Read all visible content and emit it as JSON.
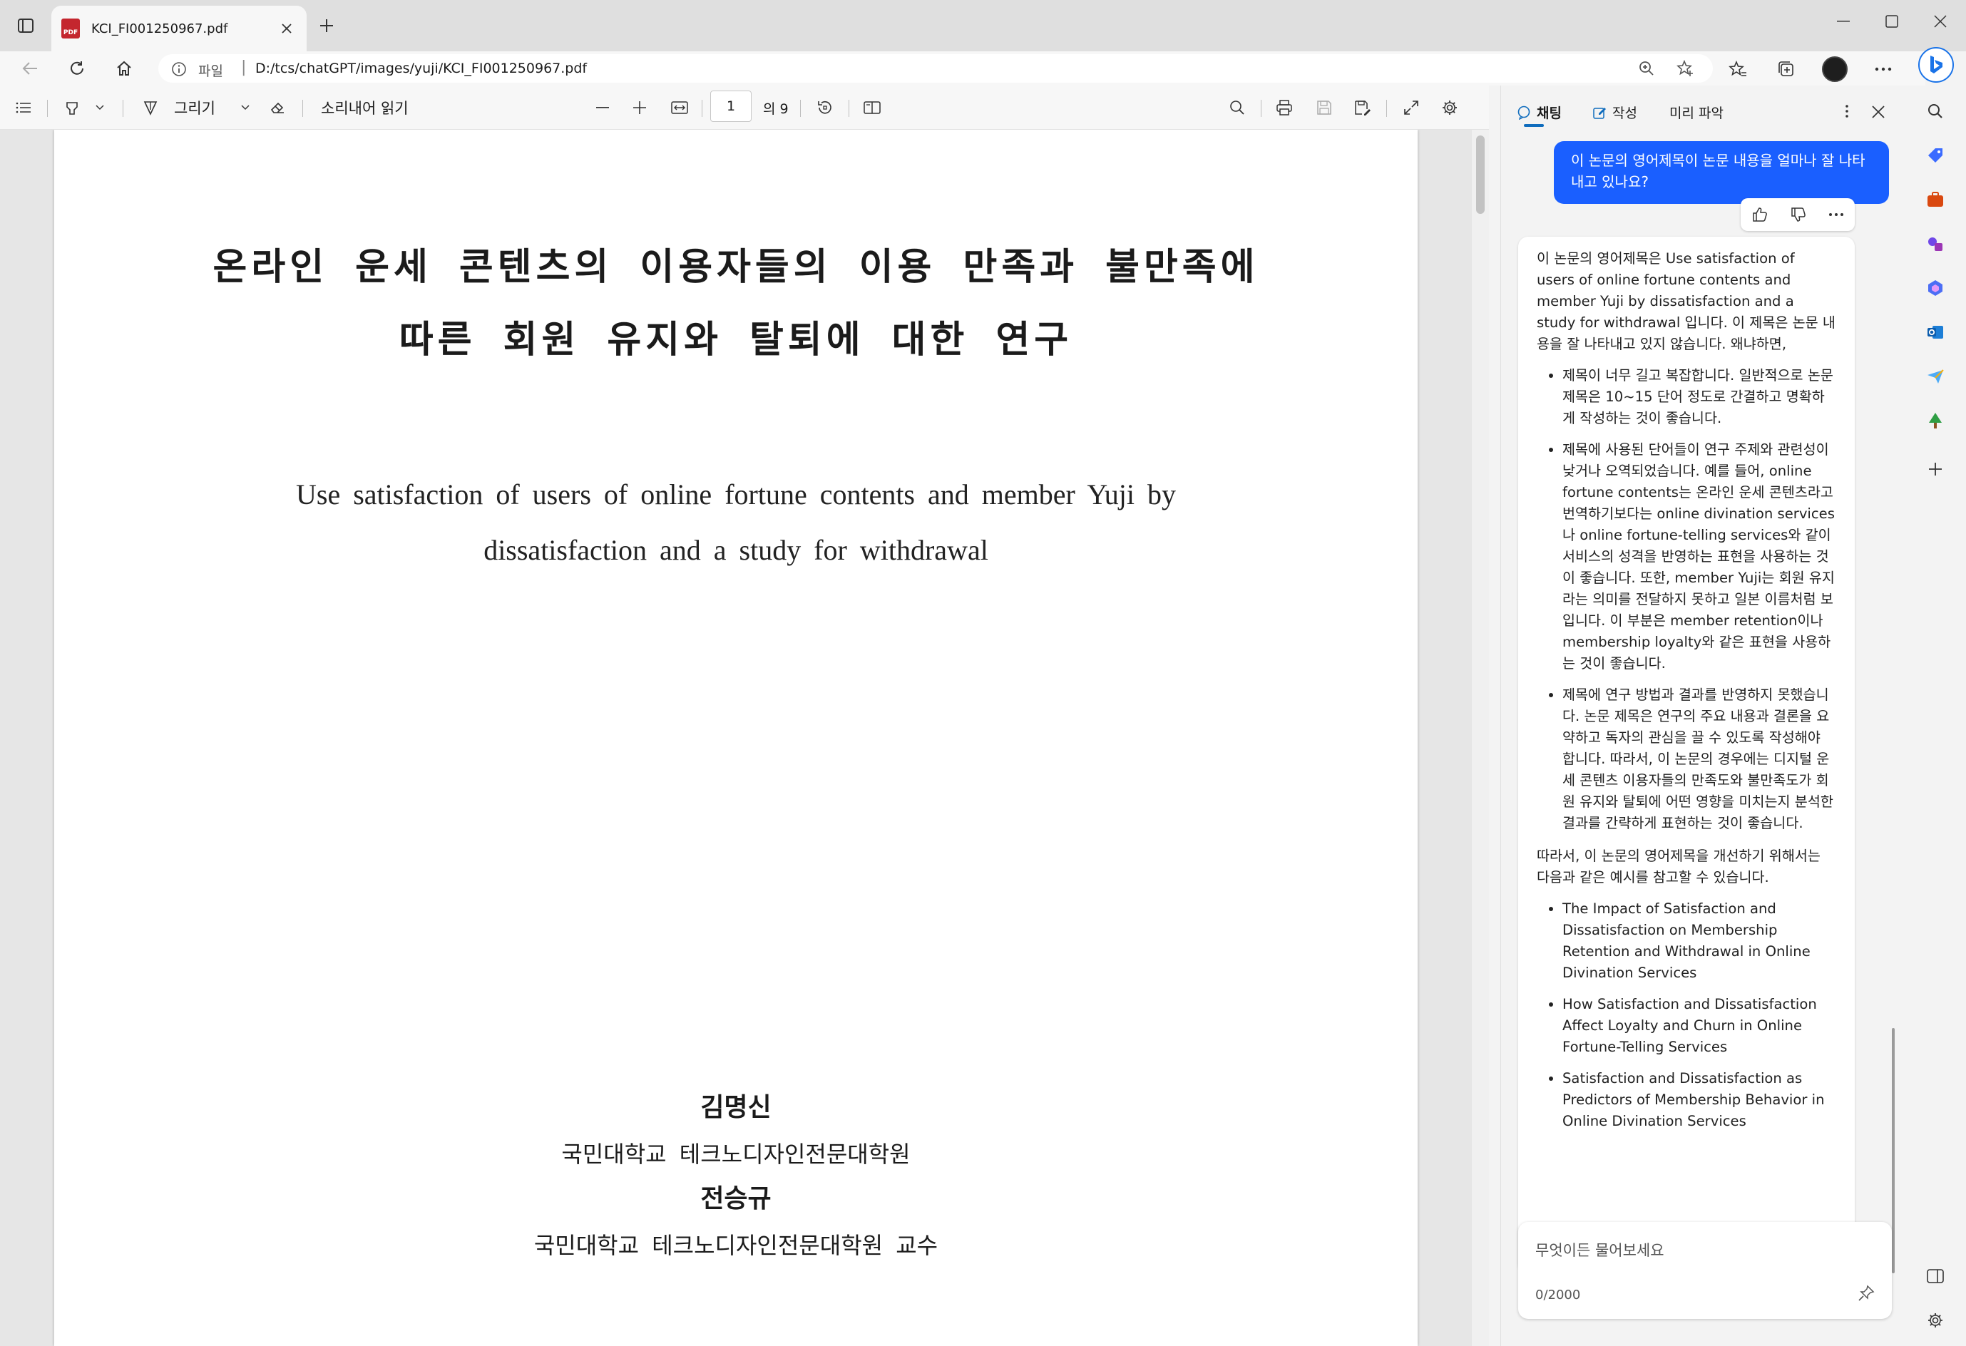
{
  "browser": {
    "tab_title": "KCI_FI001250967.pdf",
    "url_scheme": "파일",
    "url": "D:/tcs/chatGPT/images/yuji/KCI_FI001250967.pdf"
  },
  "pdf_toolbar": {
    "draw_label": "그리기",
    "read_aloud_label": "소리내어 읽기",
    "page_current": "1",
    "page_total": "의 9"
  },
  "document": {
    "korean_title_line1": "온라인 운세 콘텐츠의 이용자들의 이용 만족과 불만족에",
    "korean_title_line2": "따른 회원 유지와 탈퇴에 대한  연구",
    "english_title_line1": "Use satisfaction of users of online fortune contents and member Yuji by",
    "english_title_line2": "dissatisfaction and a study for withdrawal",
    "author1": "김명신",
    "affil1": "국민대학교 테크노디자인전문대학원",
    "author2": "전승규",
    "affil2": "국민대학교 테크노디자인전문대학원 교수"
  },
  "chat": {
    "tabs": [
      "채팅",
      "작성",
      "미리 파악"
    ],
    "user_message": "이 논문의 영어제목이 논문 내용을 얼마나 잘 나타내고 있나요?",
    "reply_intro": "이 논문의 영어제목은 Use satisfaction of users of online fortune contents and member Yuji by dissatisfaction and a study for withdrawal 입니다. 이 제목은 논문 내용을 잘 나타내고 있지 않습니다. 왜냐하면,",
    "reply_bullets": [
      "제목이 너무 길고 복잡합니다. 일반적으로 논문 제목은 10~15 단어 정도로 간결하고 명확하게 작성하는 것이 좋습니다.",
      "제목에 사용된 단어들이 연구 주제와 관련성이 낮거나 오역되었습니다. 예를 들어, online fortune contents는 온라인 운세 콘텐츠라고 번역하기보다는 online divination services나 online fortune-telling services와 같이 서비스의 성격을 반영하는 표현을 사용하는 것이 좋습니다. 또한, member Yuji는 회원 유지라는 의미를 전달하지 못하고 일본 이름처럼 보입니다. 이 부분은 member retention이나 membership loyalty와 같은 표현을 사용하는 것이 좋습니다.",
      "제목에 연구 방법과 결과를 반영하지 못했습니다. 논문 제목은 연구의 주요 내용과 결론을 요약하고 독자의 관심을 끌 수 있도록 작성해야 합니다. 따라서, 이 논문의 경우에는 디지털 운세 콘텐츠 이용자들의 만족도와 불만족도가 회원 유지와 탈퇴에 어떤 영향을 미치는지 분석한 결과를 간략하게 표현하는 것이 좋습니다."
    ],
    "reply_suggest_intro": "따라서, 이 논문의 영어제목을 개선하기 위해서는 다음과 같은 예시를 참고할 수 있습니다.",
    "reply_suggestions": [
      "The Impact of Satisfaction and Dissatisfaction on Membership Retention and Withdrawal in Online Divination Services",
      "How Satisfaction and Dissatisfaction Affect Loyalty and Churn in Online Fortune-Telling Services",
      "Satisfaction and Dissatisfaction as Predictors of Membership Behavior in Online Divination Services"
    ],
    "input_placeholder": "무엇이든 물어보세요",
    "char_count": "0/2000"
  },
  "colors": {
    "accent": "#1a5fff",
    "tab_underline": "#0f6cbd"
  }
}
